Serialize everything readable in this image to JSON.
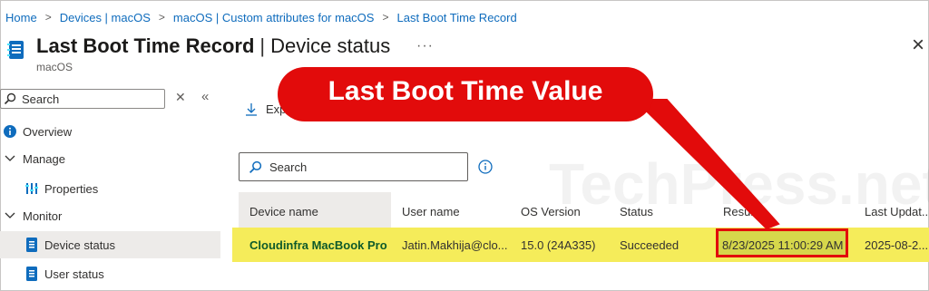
{
  "breadcrumb": [
    "Home",
    "Devices | macOS",
    "macOS | Custom attributes for macOS",
    "Last Boot Time Record"
  ],
  "header": {
    "title": "Last Boot Time Record",
    "subtitle_section": "Device status",
    "platform": "macOS",
    "more": "···",
    "close": "×"
  },
  "sidebar": {
    "search_placeholder": "Search",
    "items": [
      {
        "label": "Overview",
        "icon": "info-icon"
      },
      {
        "label": "Manage",
        "icon": "chevron-down-icon"
      },
      {
        "label": "Properties",
        "icon": "properties-icon"
      },
      {
        "label": "Monitor",
        "icon": "chevron-down-icon"
      },
      {
        "label": "Device status",
        "icon": "device-icon",
        "active": true
      },
      {
        "label": "User status",
        "icon": "user-status-icon"
      }
    ]
  },
  "toolbar": {
    "export_label": "Exp"
  },
  "grid": {
    "search_placeholder": "Search",
    "columns": [
      "Device name",
      "User name",
      "OS Version",
      "Status",
      "Result",
      "Last Updat..."
    ],
    "rows": [
      {
        "device_name": "Cloudinfra MacBook Pro",
        "user_name": "Jatin.Makhija@clo...",
        "os_version": "15.0 (24A335)",
        "status": "Succeeded",
        "result": "8/23/2025 11:00:29 AM",
        "last_updated": "2025-08-2..."
      }
    ]
  },
  "callout": {
    "text": "Last Boot Time Value"
  },
  "watermark": "TechPress.net",
  "colors": {
    "accent": "#0f6cbd",
    "callout": "#e20b0b",
    "row_highlight": "#f5ec5a",
    "result_highlight": "#d6d74b",
    "device_link": "#0e5a2a"
  }
}
